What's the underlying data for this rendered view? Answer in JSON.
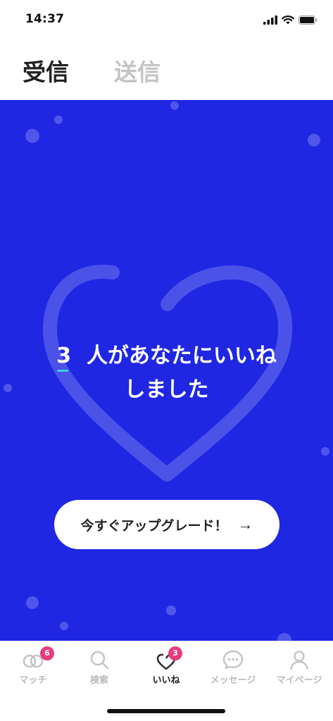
{
  "status_bar": {
    "time": "14:37"
  },
  "header": {
    "tabs": [
      {
        "label": "受信",
        "active": true
      },
      {
        "label": "送信",
        "active": false
      }
    ]
  },
  "hero": {
    "count": "3",
    "message_line1": "人があなたにいいね",
    "message_line2": "しました",
    "upgrade_label": "今すぐアップグレード！",
    "upgrade_arrow": "→"
  },
  "bottom_nav": {
    "items": [
      {
        "label": "マッチ",
        "icon": "rings-icon",
        "badge": "6"
      },
      {
        "label": "検索",
        "icon": "search-icon"
      },
      {
        "label": "いいね",
        "icon": "heart-icon",
        "badge": "3",
        "active": true
      },
      {
        "label": "メッセージ",
        "icon": "chat-bubble-icon"
      },
      {
        "label": "マイページ",
        "icon": "person-icon"
      }
    ]
  },
  "colors": {
    "hero_background": "#1f27e3",
    "badge": "#e93b80",
    "count_underline": "#35d0e8",
    "inactive": "#bbbbbb",
    "active": "#222222"
  }
}
